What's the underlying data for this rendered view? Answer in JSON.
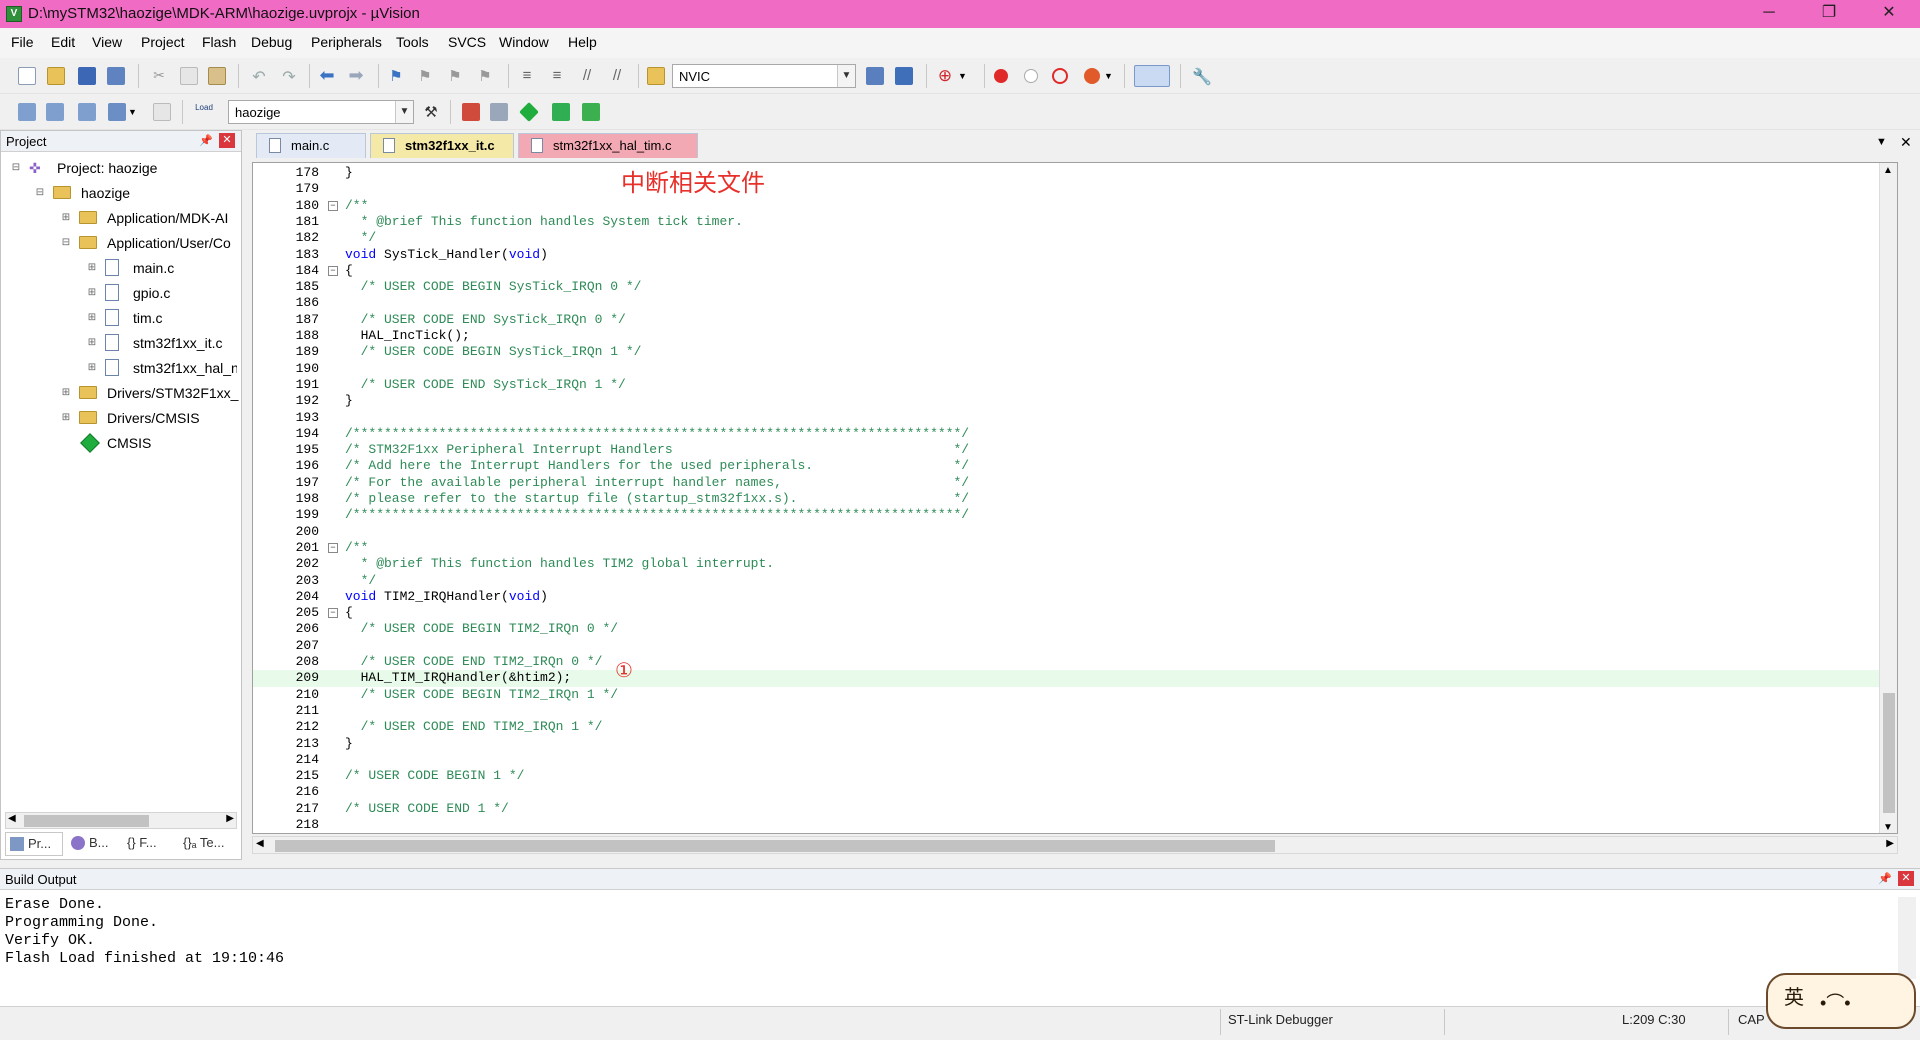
{
  "title_bar": {
    "title": "D:\\mySTM32\\haozige\\MDK-ARM\\haozige.uvprojx - µVision",
    "minimize": "─",
    "restore": "❐",
    "close": "✕"
  },
  "menu": [
    "File",
    "Edit",
    "View",
    "Project",
    "Flash",
    "Debug",
    "Peripherals",
    "Tools",
    "SVCS",
    "Window",
    "Help"
  ],
  "toolbar1": {
    "combo_value": "NVIC"
  },
  "toolbar2": {
    "target_value": "haozige",
    "load_label": "Load"
  },
  "project_panel": {
    "header": "Project",
    "tree": [
      {
        "label": "Project: haozige"
      },
      {
        "label": "haozige"
      },
      {
        "label": "Application/MDK-AI"
      },
      {
        "label": "Application/User/Co"
      },
      {
        "label": "main.c"
      },
      {
        "label": "gpio.c"
      },
      {
        "label": "tim.c"
      },
      {
        "label": "stm32f1xx_it.c"
      },
      {
        "label": "stm32f1xx_hal_n"
      },
      {
        "label": "Drivers/STM32F1xx_"
      },
      {
        "label": "Drivers/CMSIS"
      },
      {
        "label": "CMSIS"
      }
    ],
    "bottom_tabs": [
      "Pr...",
      "B...",
      "{} F...",
      "{}ₐ Te..."
    ]
  },
  "editor": {
    "tabs": [
      {
        "label": "main.c"
      },
      {
        "label": "stm32f1xx_it.c"
      },
      {
        "label": "stm32f1xx_hal_tim.c"
      }
    ],
    "annotation_cn": "中断相关文件",
    "annotation_marker": "①",
    "lines": [
      {
        "n": "178",
        "t": "}"
      },
      {
        "n": "179",
        "t": ""
      },
      {
        "n": "180",
        "t": "/**"
      },
      {
        "n": "181",
        "t": "  * @brief This function handles System tick timer."
      },
      {
        "n": "182",
        "t": "  */"
      },
      {
        "n": "183",
        "t": "void SysTick_Handler(void)"
      },
      {
        "n": "184",
        "t": "{"
      },
      {
        "n": "185",
        "t": "  /* USER CODE BEGIN SysTick_IRQn 0 */"
      },
      {
        "n": "186",
        "t": ""
      },
      {
        "n": "187",
        "t": "  /* USER CODE END SysTick_IRQn 0 */"
      },
      {
        "n": "188",
        "t": "  HAL_IncTick();"
      },
      {
        "n": "189",
        "t": "  /* USER CODE BEGIN SysTick_IRQn 1 */"
      },
      {
        "n": "190",
        "t": ""
      },
      {
        "n": "191",
        "t": "  /* USER CODE END SysTick_IRQn 1 */"
      },
      {
        "n": "192",
        "t": "}"
      },
      {
        "n": "193",
        "t": ""
      },
      {
        "n": "194",
        "t": "/******************************************************************************/"
      },
      {
        "n": "195",
        "t": "/* STM32F1xx Peripheral Interrupt Handlers                                    */"
      },
      {
        "n": "196",
        "t": "/* Add here the Interrupt Handlers for the used peripherals.                  */"
      },
      {
        "n": "197",
        "t": "/* For the available peripheral interrupt handler names,                      */"
      },
      {
        "n": "198",
        "t": "/* please refer to the startup file (startup_stm32f1xx.s).                    */"
      },
      {
        "n": "199",
        "t": "/******************************************************************************/"
      },
      {
        "n": "200",
        "t": ""
      },
      {
        "n": "201",
        "t": "/**"
      },
      {
        "n": "202",
        "t": "  * @brief This function handles TIM2 global interrupt."
      },
      {
        "n": "203",
        "t": "  */"
      },
      {
        "n": "204",
        "t": "void TIM2_IRQHandler(void)"
      },
      {
        "n": "205",
        "t": "{"
      },
      {
        "n": "206",
        "t": "  /* USER CODE BEGIN TIM2_IRQn 0 */"
      },
      {
        "n": "207",
        "t": ""
      },
      {
        "n": "208",
        "t": "  /* USER CODE END TIM2_IRQn 0 */"
      },
      {
        "n": "209",
        "t": "  HAL_TIM_IRQHandler(&htim2);"
      },
      {
        "n": "210",
        "t": "  /* USER CODE BEGIN TIM2_IRQn 1 */"
      },
      {
        "n": "211",
        "t": ""
      },
      {
        "n": "212",
        "t": "  /* USER CODE END TIM2_IRQn 1 */"
      },
      {
        "n": "213",
        "t": "}"
      },
      {
        "n": "214",
        "t": ""
      },
      {
        "n": "215",
        "t": "/* USER CODE BEGIN 1 */"
      },
      {
        "n": "216",
        "t": ""
      },
      {
        "n": "217",
        "t": "/* USER CODE END 1 */"
      },
      {
        "n": "218",
        "t": ""
      }
    ]
  },
  "build_output": {
    "header": "Build Output",
    "lines": [
      "Erase Done.",
      "Programming Done.",
      "Verify OK.",
      "Flash Load finished at 19:10:46"
    ]
  },
  "status_bar": {
    "debugger": "ST-Link Debugger",
    "position": "L:209 C:30",
    "caps": "CAP"
  },
  "colors": {
    "title_bar": "#f06cc4",
    "annotation": "#e8302a",
    "comment": "#2e8b57",
    "keyword": "#0000ff",
    "current_line": "#e8fbea"
  }
}
